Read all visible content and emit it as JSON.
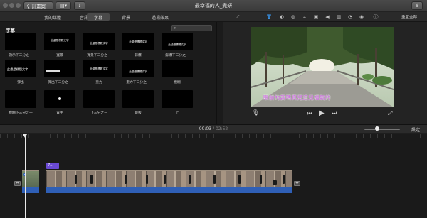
{
  "window": {
    "title": "最幸福的人_覺妍",
    "back_label": "計畫案"
  },
  "browser_tabs": [
    {
      "label": "我的媒體",
      "active": false
    },
    {
      "label": "音訊",
      "active": false
    },
    {
      "label": "字幕",
      "active": true
    },
    {
      "label": "背景",
      "active": false
    },
    {
      "label": "過場效果",
      "active": false
    }
  ],
  "adjustments": {
    "reset_all_label": "重置全部",
    "icons": [
      "magic-wand-icon",
      "title-text-icon",
      "color-balance-icon",
      "color-correction-icon",
      "crop-icon",
      "stabilization-icon",
      "volume-icon",
      "noise-reduction-icon",
      "speed-icon",
      "clip-filter-icon",
      "info-icon"
    ],
    "active_icon": "title-text-icon"
  },
  "browser": {
    "heading": "字幕",
    "search": {
      "value": "",
      "placeholder": ""
    },
    "titles": [
      {
        "label": "顯示下三分之一",
        "preview": ""
      },
      {
        "label": "寬景",
        "preview": "此處是標題文字"
      },
      {
        "label": "寬景下三分之一",
        "preview": "此處是標題文字"
      },
      {
        "label": "錄爆",
        "preview": "此處是標題文字"
      },
      {
        "label": "錄爆下三分之一",
        "preview": "此處是標題文字"
      },
      {
        "label": "彈出",
        "preview": "此處是標題文字"
      },
      {
        "label": "彈出下三分之一",
        "preview": ""
      },
      {
        "label": "重力",
        "preview": "此處是標題文字"
      },
      {
        "label": "重力下三分之一",
        "preview": "此處是標題文字"
      },
      {
        "label": "模糊",
        "preview": ""
      },
      {
        "label": "模糊下三分之一",
        "preview": ""
      },
      {
        "label": "置中",
        "preview": ""
      },
      {
        "label": "下三分之一",
        "preview": ""
      },
      {
        "label": "跳板",
        "preview": ""
      },
      {
        "label": "上",
        "preview": ""
      }
    ]
  },
  "viewer": {
    "subtitle": "眼前的我嗎真兒這兒福氣的"
  },
  "timeline": {
    "current_time": "00:03",
    "separator": "/",
    "duration": "02:52",
    "settings_label": "設定",
    "title_clip_label": "7..."
  },
  "colors": {
    "accent_blue": "#3aa0ff",
    "title_clip_purple": "#6a4ad4",
    "audio_blue": "#2f5fb6",
    "subtitle_magenta": "#c45dd8"
  }
}
